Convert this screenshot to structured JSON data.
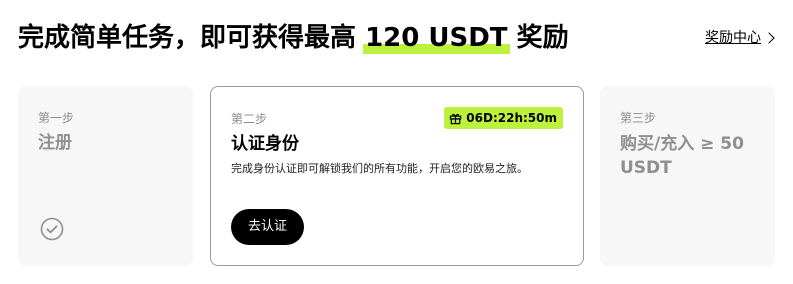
{
  "header": {
    "title_prefix": "完成简单任务，即可获得最高 ",
    "title_highlight": "120 USDT",
    "title_suffix": " 奖励",
    "reward_center_link": "奖励中心"
  },
  "steps": [
    {
      "label": "第一步",
      "title": "注册",
      "status": "completed",
      "status_icon": "check-circle-icon"
    },
    {
      "label": "第二步",
      "title": "认证身份",
      "timer": "06D:22h:50m",
      "timer_icon": "gift-icon",
      "description": "完成身份认证即可解锁我们的所有功能，开启您的欧易之旅。",
      "button_label": "去认证",
      "status": "active"
    },
    {
      "label": "第三步",
      "title": "购买/充入 ≥ 50 USDT",
      "status": "pending"
    }
  ],
  "colors": {
    "accent": "#bdf23c",
    "muted_card_bg": "#f7f7f7",
    "muted_text": "#8f8f8f",
    "button_bg": "#000000"
  }
}
